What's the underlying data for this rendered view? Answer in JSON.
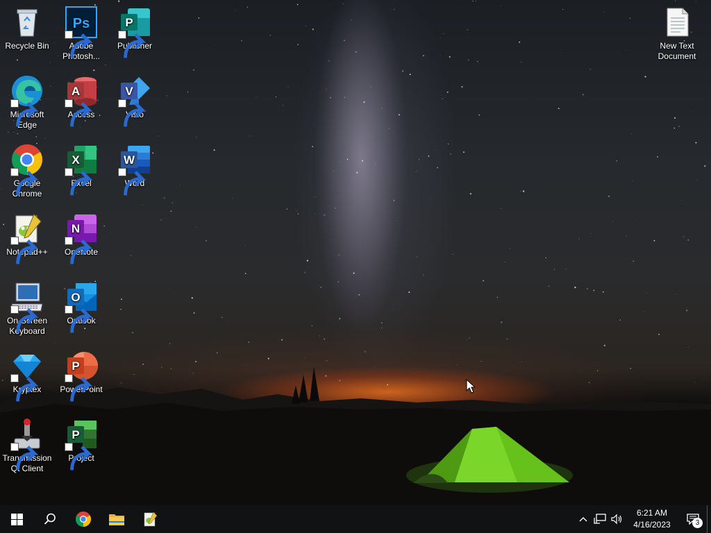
{
  "desktop": {
    "icons": [
      {
        "id": "recycle-bin",
        "label": "Recycle Bin"
      },
      {
        "id": "photoshop",
        "label": "Adobe Photosh..."
      },
      {
        "id": "publisher",
        "label": "Publisher"
      },
      {
        "id": "new-text-document",
        "label": "New Text Document"
      },
      {
        "id": "edge",
        "label": "Microsoft Edge"
      },
      {
        "id": "access",
        "label": "Access"
      },
      {
        "id": "visio",
        "label": "Visio"
      },
      {
        "id": "chrome",
        "label": "Google Chrome"
      },
      {
        "id": "excel",
        "label": "Excel"
      },
      {
        "id": "word",
        "label": "Word"
      },
      {
        "id": "notepadpp",
        "label": "Notepad++"
      },
      {
        "id": "onenote",
        "label": "OneNote"
      },
      {
        "id": "osk",
        "label": "On-Screen Keyboard"
      },
      {
        "id": "outlook",
        "label": "Outlook"
      },
      {
        "id": "kryptex",
        "label": "Kryptex"
      },
      {
        "id": "powerpoint",
        "label": "PowerPoint"
      },
      {
        "id": "transmission",
        "label": "Transmission Qt Client"
      },
      {
        "id": "project",
        "label": "Project"
      }
    ],
    "icon_letters": {
      "photoshop": "Ps",
      "publisher": "P",
      "access": "A",
      "visio": "V",
      "excel": "X",
      "word": "W",
      "onenote": "N",
      "outlook": "O",
      "powerpoint": "P",
      "project": "P"
    }
  },
  "taskbar": {
    "start_icon": "windows-logo-icon",
    "search_icon": "search-icon",
    "pinned": [
      {
        "id": "chrome",
        "icon": "chrome-icon"
      },
      {
        "id": "file-explorer",
        "icon": "folder-icon"
      },
      {
        "id": "notepadpp",
        "icon": "notepadpp-icon"
      }
    ],
    "tray": {
      "time": "6:21 AM",
      "date": "4/16/2023",
      "notification_count": "3"
    }
  },
  "colors": {
    "taskbar": "#101214",
    "excel": "#1e7145",
    "word": "#2b579a",
    "powerpoint": "#d24726",
    "onenote": "#7719aa",
    "outlook": "#0f6cbd",
    "access": "#a4373a",
    "publisher": "#077568",
    "visio": "#3955a3",
    "project": "#31752f",
    "photoshop": "#001e36"
  }
}
